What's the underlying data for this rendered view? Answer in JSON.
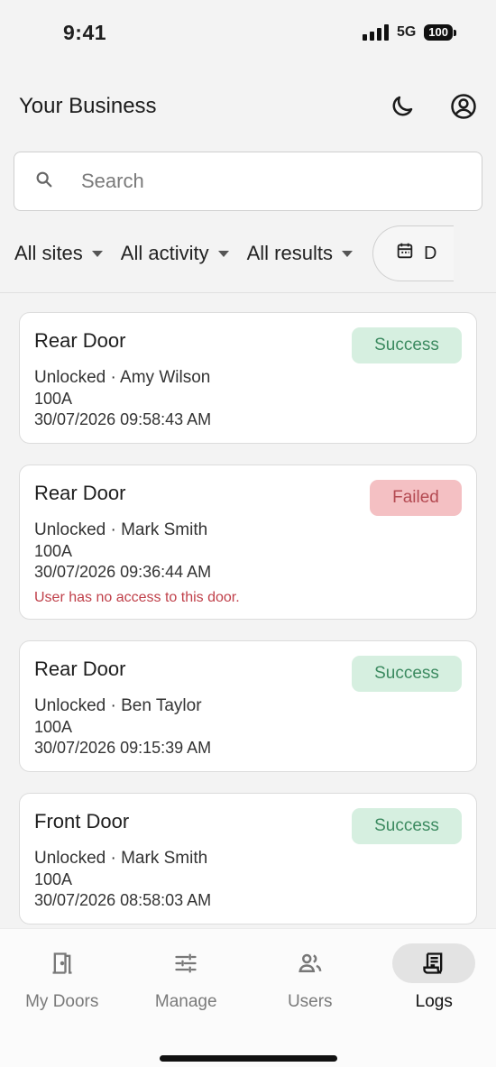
{
  "status_bar": {
    "time": "9:41",
    "network": "5G",
    "battery": "100"
  },
  "header": {
    "title": "Your Business",
    "theme_icon": "moon-icon",
    "account_icon": "account-circle-icon"
  },
  "search": {
    "placeholder": "Search",
    "value": ""
  },
  "filters": {
    "site": "All sites",
    "activity": "All activity",
    "results": "All results",
    "date_label": "D"
  },
  "logs": [
    {
      "door": "Rear Door",
      "action": "Unlocked · Amy Wilson",
      "unit": "100A",
      "timestamp": "30/07/2026 09:58:43 AM",
      "status": "Success"
    },
    {
      "door": "Rear Door",
      "action": "Unlocked · Mark Smith",
      "unit": "100A",
      "timestamp": "30/07/2026 09:36:44 AM",
      "status": "Failed",
      "error": "User has no access to this door."
    },
    {
      "door": "Rear Door",
      "action": "Unlocked · Ben Taylor",
      "unit": "100A",
      "timestamp": "30/07/2026 09:15:39 AM",
      "status": "Success"
    },
    {
      "door": "Front Door",
      "action": "Unlocked · Mark Smith",
      "unit": "100A",
      "timestamp": "30/07/2026 08:58:03 AM",
      "status": "Success"
    }
  ],
  "colors": {
    "success_bg": "#d6efe0",
    "success_text": "#3c8a60",
    "failed_bg": "#f4c0c3",
    "failed_text": "#b44a52",
    "error_text": "#c0404a"
  },
  "nav": {
    "items": [
      {
        "label": "My Doors",
        "icon": "door-icon"
      },
      {
        "label": "Manage",
        "icon": "sliders-icon"
      },
      {
        "label": "Users",
        "icon": "users-icon"
      },
      {
        "label": "Logs",
        "icon": "logs-icon",
        "active": true
      }
    ]
  }
}
